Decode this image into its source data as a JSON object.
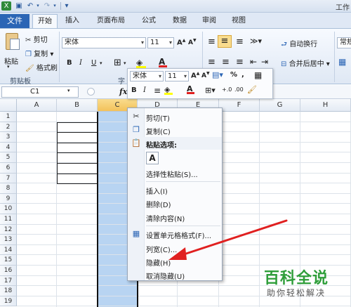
{
  "app": {
    "title_partial": "工作",
    "quick_access": {
      "save": "💾",
      "undo": "↶",
      "redo": "↷",
      "customize": "▾"
    }
  },
  "ribbon_tabs": [
    {
      "label": "文件"
    },
    {
      "label": "开始",
      "active": true
    },
    {
      "label": "插入"
    },
    {
      "label": "页面布局"
    },
    {
      "label": "公式"
    },
    {
      "label": "数据"
    },
    {
      "label": "审阅"
    },
    {
      "label": "视图"
    }
  ],
  "ribbon": {
    "clipboard": {
      "paste_label": "粘贴",
      "cut": "剪切",
      "copy": "复制 ▾",
      "format_painter": "格式刷",
      "group_label": "剪贴板"
    },
    "font": {
      "font_name": "宋体",
      "font_size": "11",
      "bold": "B",
      "italic": "I",
      "underline": "U",
      "group_label_partial": "字"
    },
    "alignment": {
      "wrap_text": "自动换行",
      "merge_center": "合并后居中 ▾"
    },
    "number": {
      "format": "常规"
    }
  },
  "formula_bar": {
    "name_box": "C1",
    "fx": "fx"
  },
  "sheet": {
    "columns": [
      "A",
      "B",
      "C",
      "D",
      "E",
      "F",
      "G",
      "H"
    ],
    "rows": [
      "1",
      "2",
      "3",
      "4",
      "5",
      "6",
      "7",
      "8",
      "9",
      "10",
      "11",
      "12",
      "13",
      "14",
      "15",
      "16",
      "17",
      "18",
      "19"
    ],
    "selected_column": "C"
  },
  "mini_toolbar": {
    "font_name": "宋体",
    "font_size": "11",
    "bold": "B",
    "italic": "I",
    "percent": "%",
    "comma": ","
  },
  "context_menu": {
    "items": [
      {
        "label": "剪切(T)",
        "icon": "scissors-icon"
      },
      {
        "label": "复制(C)",
        "icon": "copy-icon"
      },
      {
        "label": "粘贴选项:",
        "icon": "paste-icon"
      },
      {
        "label": "A",
        "icon": "paste-option-icon"
      },
      {
        "label": "选择性粘贴(S)..."
      },
      {
        "label": "插入(I)"
      },
      {
        "label": "删除(D)"
      },
      {
        "label": "清除内容(N)"
      },
      {
        "label": "设置单元格格式(F)...",
        "icon": "format-cells-icon"
      },
      {
        "label": "列宽(C)..."
      },
      {
        "label": "隐藏(H)"
      },
      {
        "label": "取消隐藏(U)"
      }
    ]
  },
  "watermark": {
    "main": "百科全说",
    "sub": "助你轻松解决"
  },
  "colors": {
    "accent_blue": "#2b65b5",
    "selection_fill": "#b8d4f2",
    "annotation_red": "#e02020",
    "watermark_green": "#2f9e3a"
  }
}
